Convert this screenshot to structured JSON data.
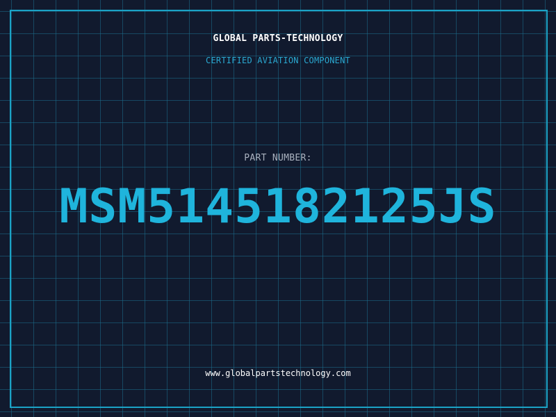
{
  "card": {
    "brand": "GLOBAL PARTS-TECHNOLOGY",
    "subtitle": "CERTIFIED AVIATION COMPONENT",
    "part_label": "PART NUMBER:",
    "part_number": "MSM5145182125JS",
    "website": "www.globalpartstechnology.com"
  },
  "colors": {
    "background": "#111a2e",
    "grid": "#1b6e8c",
    "accent": "#1fb4dc",
    "frame": "#1ba3c6"
  }
}
